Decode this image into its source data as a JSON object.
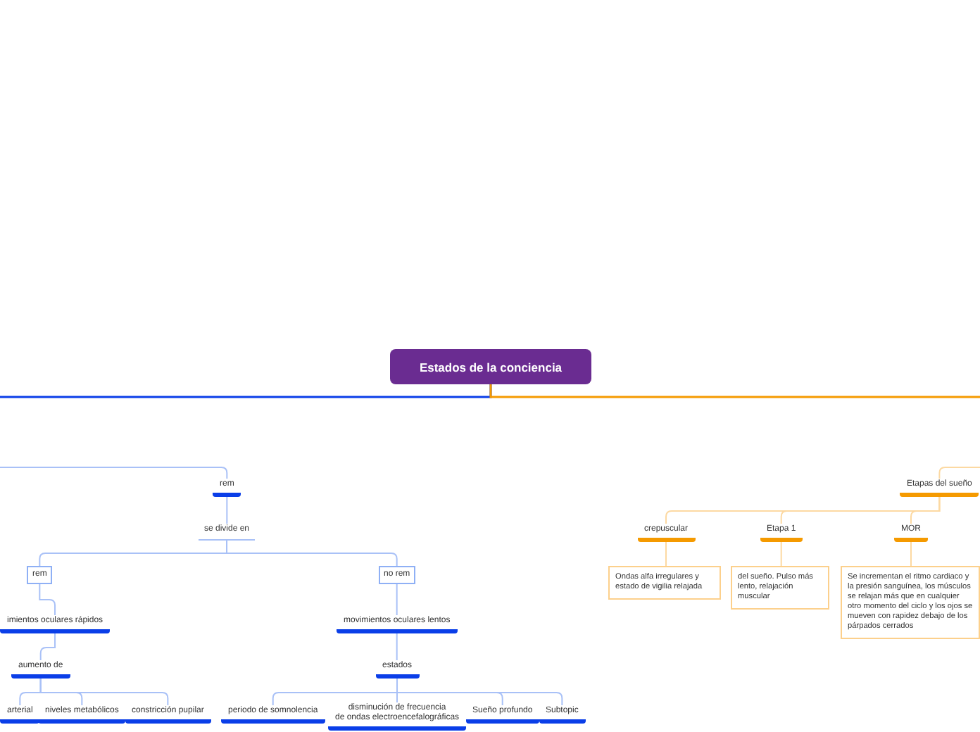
{
  "central_topic": {
    "title": "Estados de la conciencia"
  },
  "branches": [
    {
      "color": "#0a3ee8",
      "children": [
        {
          "label": "rem",
          "kind": "topic",
          "children": [
            {
              "label": "se divide en",
              "kind": "plain",
              "children": [
                {
                  "label": "rem",
                  "kind": "boxed",
                  "children": [
                    {
                      "label": "imientos oculares rápidos",
                      "kind": "topic",
                      "children": [
                        {
                          "label": "aumento de",
                          "kind": "topic",
                          "children": [
                            {
                              "label": "arterial",
                              "kind": "topic"
                            },
                            {
                              "label": "niveles metabólicos",
                              "kind": "topic"
                            },
                            {
                              "label": "constricción pupilar",
                              "kind": "topic"
                            }
                          ]
                        }
                      ]
                    }
                  ]
                },
                {
                  "label": "no rem",
                  "kind": "boxed",
                  "children": [
                    {
                      "label": "movimientos oculares lentos",
                      "kind": "topic",
                      "children": [
                        {
                          "label": "estados",
                          "kind": "topic",
                          "children": [
                            {
                              "label": "periodo de somnolencia",
                              "kind": "topic"
                            },
                            {
                              "label": "disminución de frecuencia\nde ondas electroencefalográficas",
                              "kind": "topic"
                            },
                            {
                              "label": "Sueño profundo",
                              "kind": "topic"
                            },
                            {
                              "label": "Subtopic",
                              "kind": "topic"
                            }
                          ]
                        }
                      ]
                    }
                  ]
                }
              ]
            }
          ]
        }
      ]
    },
    {
      "color": "#f59a00",
      "children": [
        {
          "label": "Etapas del sueño",
          "kind": "topic",
          "children": [
            {
              "label": "crepuscular",
              "kind": "topic",
              "children": [
                {
                  "label": "Ondas alfa irregulares y estado de vigilia relajada",
                  "kind": "note"
                }
              ]
            },
            {
              "label": "Etapa 1",
              "kind": "topic",
              "children": [
                {
                  "label": "del sueño. Pulso más lento, relajación muscular",
                  "kind": "note"
                }
              ]
            },
            {
              "label": "MOR",
              "kind": "topic",
              "children": [
                {
                  "label": "Se incrementan el ritmo cardiaco y la presión sanguínea, los músculos se relajan más que en cualquier otro momento del ciclo y los ojos se mueven con rapidez debajo de los párpados cerrados",
                  "kind": "note"
                }
              ]
            }
          ]
        }
      ]
    }
  ]
}
